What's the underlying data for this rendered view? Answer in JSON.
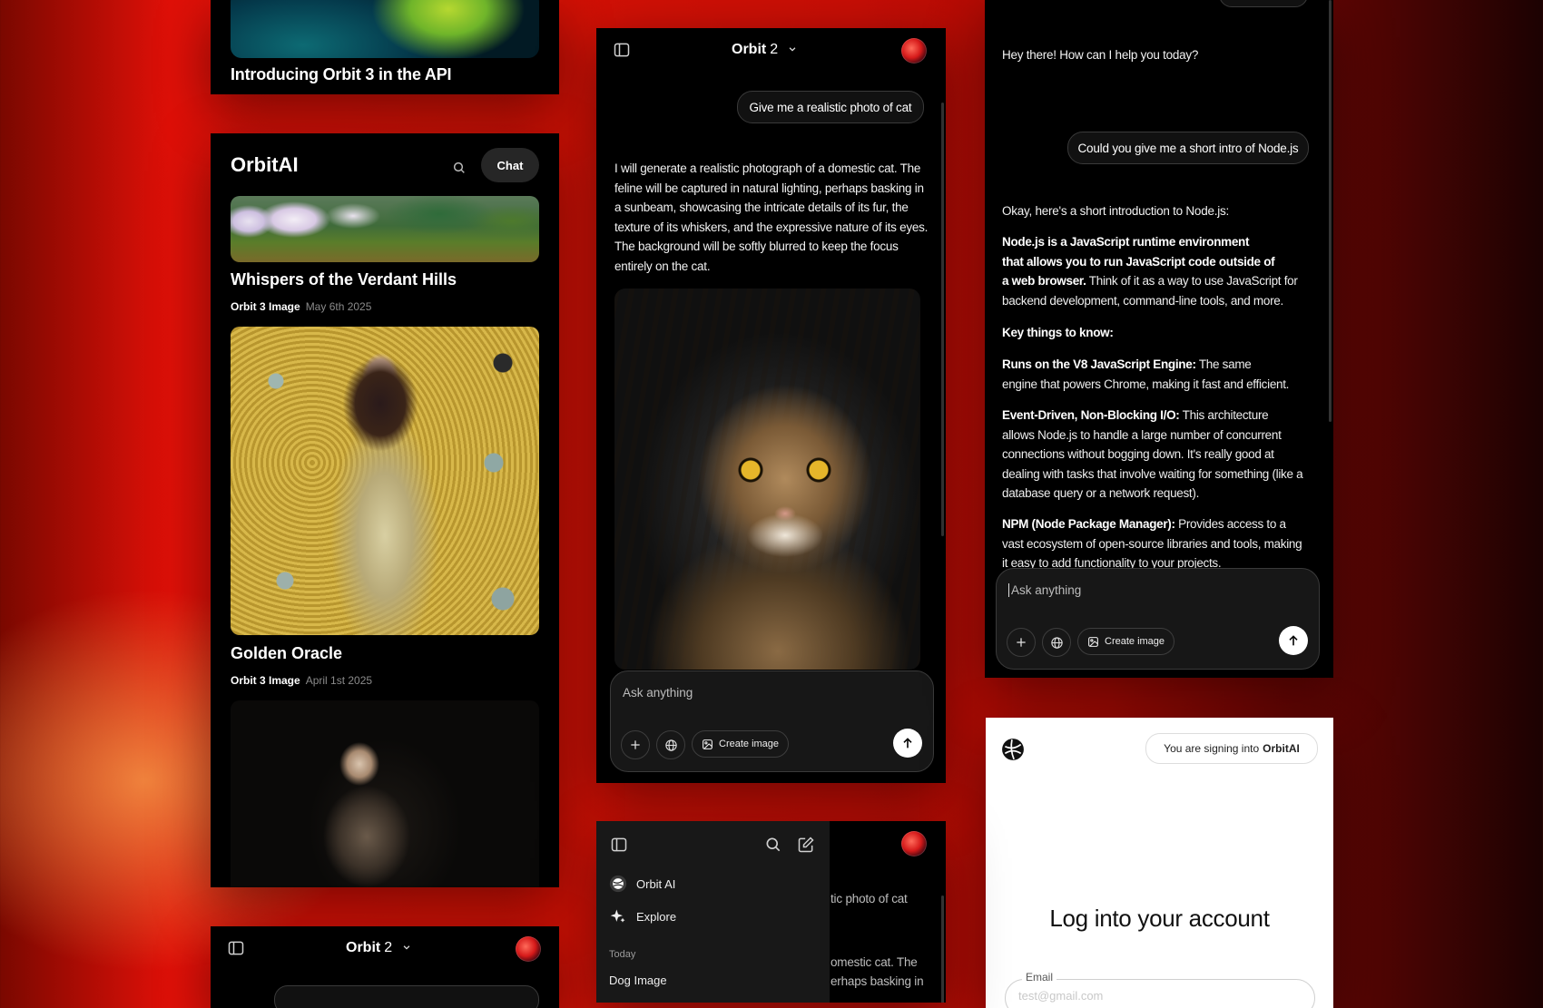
{
  "panel_a": {
    "title": "Introducing Orbit 3 in the API"
  },
  "gallery": {
    "brand": "OrbitAI",
    "chat_button": "Chat",
    "cards": [
      {
        "title": "Whispers of the Verdant Hills",
        "model": "Orbit 3 Image",
        "date": "May 6th 2025"
      },
      {
        "title": "Golden Oracle",
        "model": "Orbit 3 Image",
        "date": "April 1st 2025"
      }
    ]
  },
  "chat_cat": {
    "model": "Orbit",
    "version": "2",
    "user_message": "Give me a realistic photo of cat",
    "reply_lines": [
      "I will generate a realistic photograph of a domestic cat. The",
      "feline will be captured in natural lighting, perhaps basking in",
      "a sunbeam, showcasing the intricate details of its fur, the",
      "texture of its whiskers, and the expressive nature of its eyes.",
      "The background will be softly blurred to keep the focus",
      "entirely on the cat."
    ],
    "composer_placeholder": "Ask anything",
    "create_image": "Create image"
  },
  "chat_node": {
    "greeting": "Hey there! How can I help you today?",
    "user_message": "Could you give me a short intro of Node.js",
    "intro": "Okay, here's a short introduction to Node.js:",
    "p1_lines": [
      "Node.js is a JavaScript runtime environment",
      "that allows you to run JavaScript code outside of",
      "a web browser.",
      " Think of it as a way to use JavaScript for",
      "backend development, command-line tools, and more."
    ],
    "key_heading": "Key things to know:",
    "p2_lines": [
      "Runs on the V8 JavaScript Engine:",
      " The same",
      "engine that powers Chrome, making it fast and efficient."
    ],
    "p3_lines": [
      "Event-Driven, Non-Blocking I/O:",
      " This architecture",
      "allows Node.js to handle a large number of concurrent",
      "connections without bogging down. It's really good at",
      "dealing with tasks that involve waiting for something (like a",
      "database query or a network request)."
    ],
    "p4_lines": [
      "NPM (Node Package Manager):",
      " Provides access to a",
      "vast ecosystem of open-source libraries and tools, making",
      "it easy to add functionality to your projects."
    ],
    "composer_placeholder": "Ask anything",
    "create_image": "Create image"
  },
  "login": {
    "pill_prefix": "You are signing into",
    "pill_brand": "OrbitAI",
    "heading": "Log into your account",
    "email_label": "Email",
    "email_placeholder": "test@gmail.com"
  },
  "bottom_chat": {
    "model": "Orbit",
    "version": "2"
  },
  "sidebar": {
    "items": [
      {
        "label": "Orbit AI"
      },
      {
        "label": "Explore"
      }
    ],
    "section": "Today",
    "chats": [
      {
        "label": "Dog Image"
      }
    ],
    "peek_lines": [
      "tic photo of cat",
      "omestic cat. The",
      "erhaps basking in"
    ]
  },
  "colors": {
    "background_red": "#d81206",
    "panel_black": "#000000",
    "bubble_border": "#3a3a3a"
  }
}
